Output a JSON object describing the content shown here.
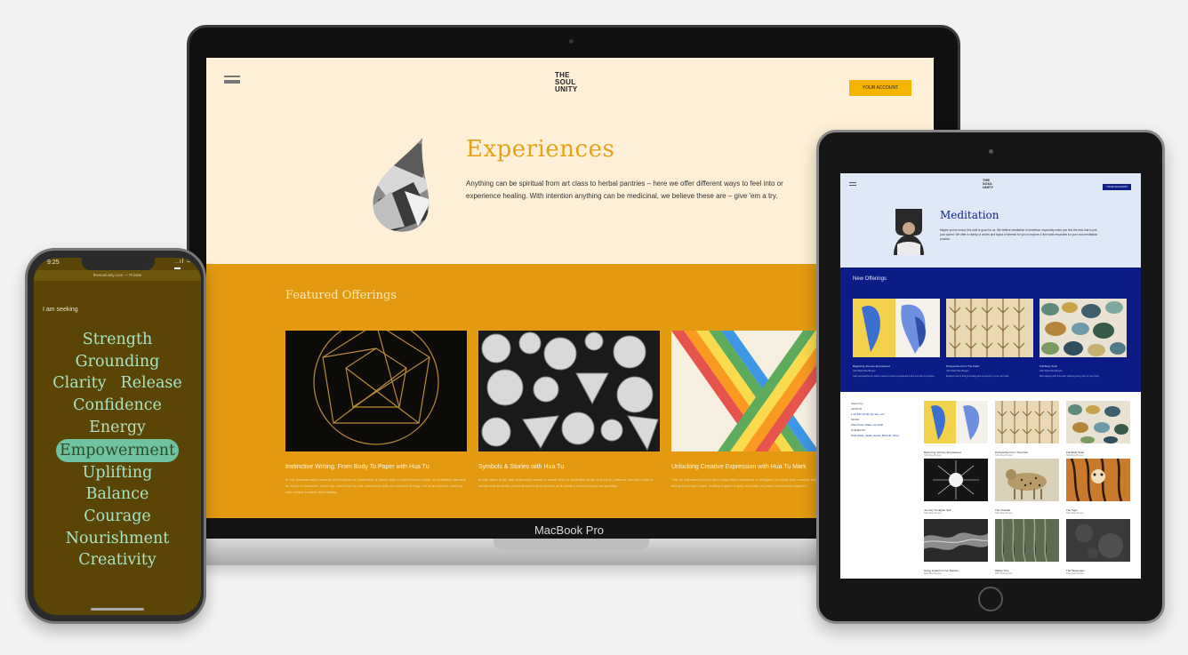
{
  "laptop": {
    "label": "MacBook Pro",
    "site": {
      "logo": [
        "THE",
        "SOUL",
        "UNITY"
      ],
      "account_button": "YOUR ACCOUNT",
      "hero_title": "Experiences",
      "hero_body": "Anything can be spiritual from art class to herbal pantries – here we offer different ways to feel into or experience healing. With intention anything can be medicinal, we believe these are – give 'em a try.",
      "featured_title": "Featured Offerings",
      "cards": [
        {
          "title": "Instinctive Writing: From Body To Paper with Hua Tu",
          "desc": "In this transformation session we'll explore an instinctive & visual ritual to find freedom inside an unfolding narrative for body or character, move out, and focus on our connection with our creative energy, our inner teacher, and our own unique creative and healing."
        },
        {
          "title": "Symbols & Stories with Hua Tu",
          "desc": "In this class, artist, self-expression coach & coach Hua Tu facilitates study of ancient, patterns, and and tools to create and decipher personal symbols to cherish and create a story through composition."
        },
        {
          "title": "Unlocking Creative Expression with Hua Tu Mark",
          "desc": "This all important journey and composition workshop is designed to unlock your creative mind, spark process from being to you and more, inviting a place to play and play, no paper experience required."
        }
      ]
    }
  },
  "phone": {
    "time": "9:25",
    "status": "..ıl ≈ ▬",
    "url": "thesoulunity.com — Private",
    "prompt": "I am seeking",
    "words": {
      "strength": "Strength",
      "grounding": "Grounding",
      "clarity": "Clarity",
      "release": "Release",
      "confidence": "Confidence",
      "energy": "Energy",
      "empowerment": "Empowerment",
      "uplifting": "Uplifting",
      "balance": "Balance",
      "courage": "Courage",
      "nourishment": "Nourishment",
      "creativity": "Creativity"
    },
    "selected": "Empowerment"
  },
  "tablet": {
    "logo": [
      "THE",
      "SOUL",
      "UNITY"
    ],
    "account_button": "YOUR ACCOUNT",
    "title": "Meditation",
    "body": "Maybe you've heard, this stuff is good for us. We believe meditation is beneficial, especially when you find the kind that is just your speed. We offer a variety of voices and topics of interest for you to explore & find what resonates for your own meditation practice.",
    "new_offerings_title": "New Offerings",
    "new_cards": [
      {
        "title": "Beginning Journey Empowered",
        "sub": "with Nikki Mae Bergen",
        "desc": "Gain perspective on what it means to feel empowered & find out how to practice."
      },
      {
        "title": "Perspective From The Field",
        "sub": "with Nikki Mae Bergen",
        "desc": "Explore how to find grounding and presence in your own field."
      },
      {
        "title": "Full Body Scan",
        "sub": "with Nikki Mae Bergen",
        "desc": "Rest deeply with this scan relaxing every part of your body."
      }
    ],
    "filters": {
      "search_by": "Search by",
      "length_label": "LENGTH",
      "length_values": "1-10 Min  10-20 min  20+ min",
      "mood_label": "MOOD",
      "mood_values": "Wind Down  Wake Up  Uplift",
      "guides_label": "GUIDED BY",
      "guides_values": "Nina Wells, Jaden Garza, Michelle, More"
    },
    "grid": [
      {
        "title": "Beginning Journey Empowered",
        "sub": "Nikki Mae Bergen"
      },
      {
        "title": "Perspective From The Field",
        "sub": "Nikki Mae Bergen"
      },
      {
        "title": "Full Body Scan",
        "sub": "Nikki Mae Bergen"
      },
      {
        "title": "Journey To Higher Self",
        "sub": "Nikki Mae Bergen"
      },
      {
        "title": "The Cheetah",
        "sub": "Nikki Mae Bergen"
      },
      {
        "title": "The Tiger",
        "sub": "Nikki Mae Bergen"
      },
      {
        "title": "Going Inward w/ Our Teacher",
        "sub": "Nikki Mae Bergen"
      },
      {
        "title": "Willow Tree",
        "sub": "Nikki Mae Bergen"
      },
      {
        "title": "The Messenger",
        "sub": "Nikki Mae Bergen"
      }
    ]
  },
  "colors": {
    "accent_orange": "#e39a10",
    "accent_yellow": "#f5b400",
    "cream": "#fdf0d6",
    "phone_bg": "#5a4506",
    "mint": "#a9e4c4",
    "navy": "#0b1c86"
  }
}
